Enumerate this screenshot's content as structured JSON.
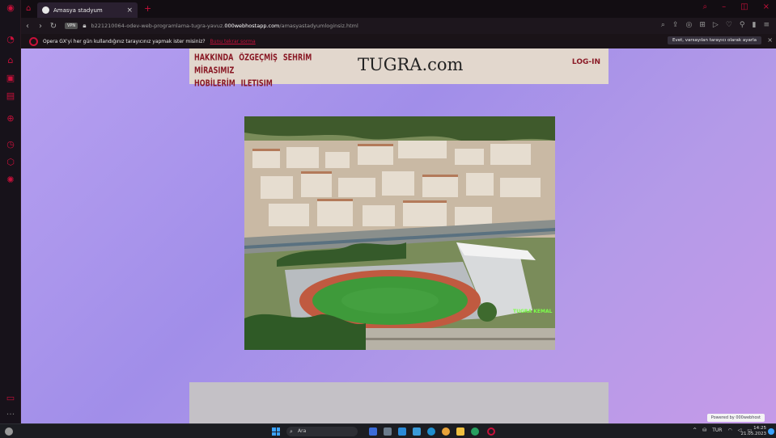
{
  "browser": {
    "tab_title": "Amasya stadyum",
    "url_prefix": "b221210064-odev-web-programlama-tugra-yavuz.",
    "url_domain": "000webhostapp.com",
    "url_path": "/amasyastadyumloginsiz.html",
    "vpn_label": "VPN",
    "infobar_message": "Opera GX'yi her gün kullandığınız tarayıcınız yapmak ister misiniz?",
    "infobar_no": "Bunu tekrar sorma",
    "infobar_yes": "Evet, varsayılan tarayıcı olarak ayarla"
  },
  "site": {
    "nav": [
      "HAKKINDA",
      "ÖZGEÇMİŞ",
      "SEHRİM",
      "MİRASIMIZ",
      "HOBİLERİM",
      "ILETISIM"
    ],
    "title": "TUGRA.com",
    "login": "LOG-IN",
    "image_label": "TUGRA KEMAL",
    "powered_by": "Powered by 000webhost"
  },
  "taskbar": {
    "search_placeholder": "Ara",
    "lang": "TUR",
    "time": "14:25",
    "date": "21.05.2023"
  }
}
